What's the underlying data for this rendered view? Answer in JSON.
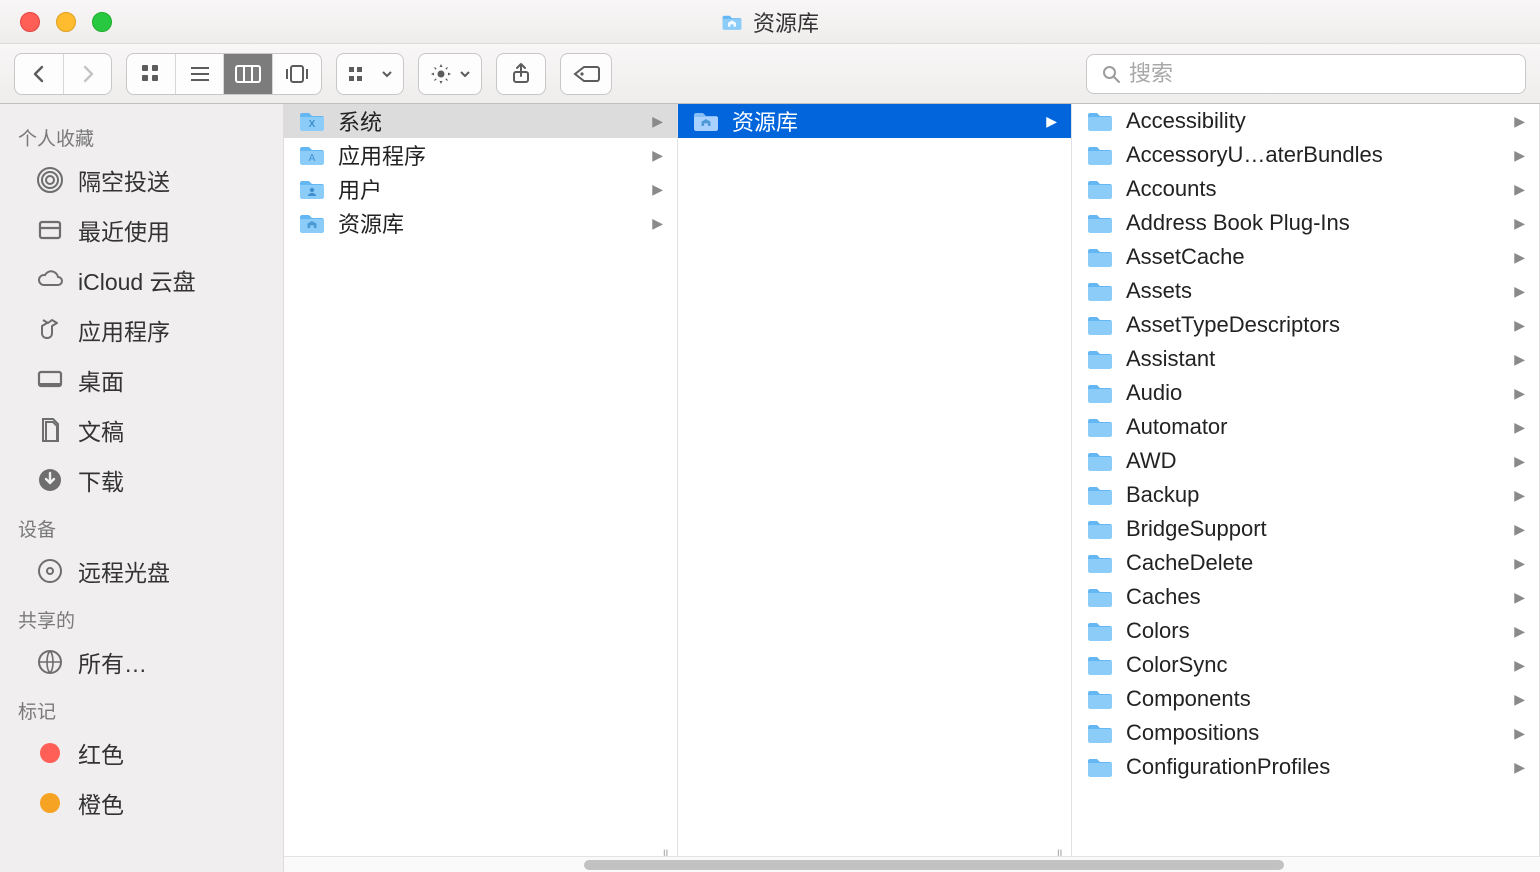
{
  "window": {
    "title": "资源库"
  },
  "toolbar": {
    "search_placeholder": "搜索"
  },
  "sidebar": {
    "sections": [
      {
        "title": "个人收藏",
        "items": [
          {
            "label": "隔空投送",
            "icon": "airdrop"
          },
          {
            "label": "最近使用",
            "icon": "recents"
          },
          {
            "label": "iCloud 云盘",
            "icon": "icloud"
          },
          {
            "label": "应用程序",
            "icon": "applications"
          },
          {
            "label": "桌面",
            "icon": "desktop"
          },
          {
            "label": "文稿",
            "icon": "documents"
          },
          {
            "label": "下载",
            "icon": "downloads"
          }
        ]
      },
      {
        "title": "设备",
        "items": [
          {
            "label": "远程光盘",
            "icon": "disc"
          }
        ]
      },
      {
        "title": "共享的",
        "items": [
          {
            "label": "所有…",
            "icon": "network"
          }
        ]
      },
      {
        "title": "标记",
        "items": [
          {
            "label": "红色",
            "icon": "tag",
            "color": "#ff5f57"
          },
          {
            "label": "橙色",
            "icon": "tag",
            "color": "#f6a324"
          }
        ]
      }
    ]
  },
  "columns": [
    {
      "items": [
        {
          "label": "系统",
          "folder": "system",
          "selected": "gray"
        },
        {
          "label": "应用程序",
          "folder": "apps"
        },
        {
          "label": "用户",
          "folder": "users"
        },
        {
          "label": "资源库",
          "folder": "library"
        }
      ]
    },
    {
      "items": [
        {
          "label": "资源库",
          "folder": "library",
          "selected": "blue"
        }
      ]
    },
    {
      "items": [
        {
          "label": "Accessibility",
          "folder": "plain"
        },
        {
          "label": "AccessoryU…aterBundles",
          "folder": "plain"
        },
        {
          "label": "Accounts",
          "folder": "plain"
        },
        {
          "label": "Address Book Plug-Ins",
          "folder": "plain"
        },
        {
          "label": "AssetCache",
          "folder": "plain"
        },
        {
          "label": "Assets",
          "folder": "plain"
        },
        {
          "label": "AssetTypeDescriptors",
          "folder": "plain"
        },
        {
          "label": "Assistant",
          "folder": "plain"
        },
        {
          "label": "Audio",
          "folder": "plain"
        },
        {
          "label": "Automator",
          "folder": "plain"
        },
        {
          "label": "AWD",
          "folder": "plain"
        },
        {
          "label": "Backup",
          "folder": "plain"
        },
        {
          "label": "BridgeSupport",
          "folder": "plain"
        },
        {
          "label": "CacheDelete",
          "folder": "plain"
        },
        {
          "label": "Caches",
          "folder": "plain"
        },
        {
          "label": "Colors",
          "folder": "plain"
        },
        {
          "label": "ColorSync",
          "folder": "plain"
        },
        {
          "label": "Components",
          "folder": "plain"
        },
        {
          "label": "Compositions",
          "folder": "plain"
        },
        {
          "label": "ConfigurationProfiles",
          "folder": "plain"
        }
      ]
    }
  ]
}
